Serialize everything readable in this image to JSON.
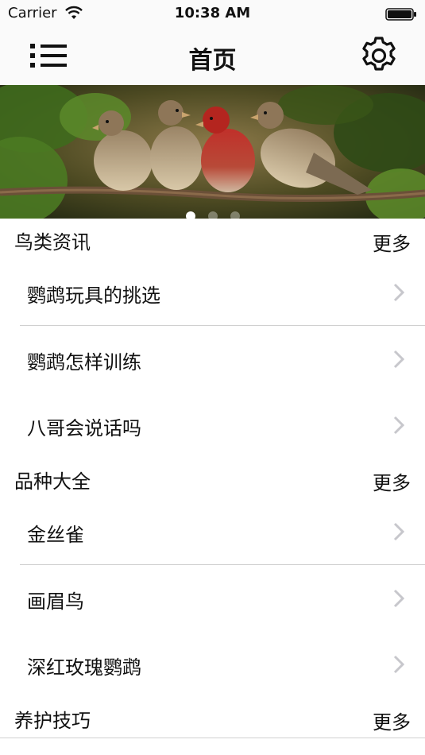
{
  "status_bar": {
    "carrier": "Carrier",
    "time": "10:38 AM"
  },
  "nav": {
    "title": "首页",
    "menu_icon": "list-icon",
    "settings_icon": "gear-icon"
  },
  "banner": {
    "page_count": 3,
    "current_page": 1
  },
  "sections": [
    {
      "title": "鸟类资讯",
      "more": "更多",
      "items": [
        "鹦鹉玩具的挑选",
        "鹦鹉怎样训练",
        "八哥会说话吗"
      ]
    },
    {
      "title": "品种大全",
      "more": "更多",
      "items": [
        "金丝雀",
        "画眉鸟",
        "深红玫瑰鹦鹉"
      ]
    },
    {
      "title": "养护技巧",
      "more": "更多",
      "items": []
    }
  ]
}
